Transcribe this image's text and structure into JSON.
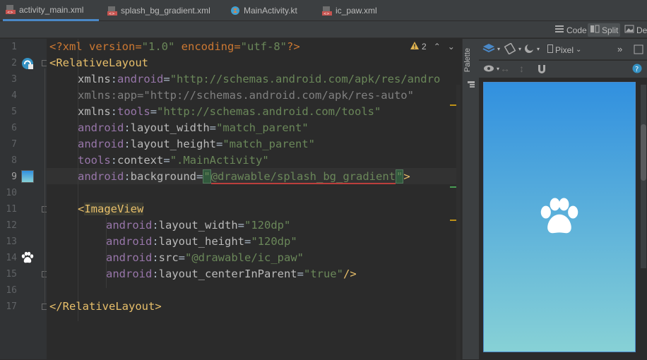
{
  "tabs": [
    {
      "label": "activity_main.xml",
      "icon": "xml-file-icon",
      "active": true
    },
    {
      "label": "splash_bg_gradient.xml",
      "icon": "xml-file-icon",
      "active": false
    },
    {
      "label": "MainActivity.kt",
      "icon": "kotlin-file-icon",
      "active": false
    },
    {
      "label": "ic_paw.xml",
      "icon": "xml-file-icon",
      "active": false
    }
  ],
  "view_modes": {
    "code": "Code",
    "split": "Split",
    "design": "Des"
  },
  "inspection": {
    "warning_count": "2"
  },
  "line_numbers": [
    "1",
    "2",
    "3",
    "4",
    "5",
    "6",
    "7",
    "8",
    "9",
    "10",
    "11",
    "12",
    "13",
    "14",
    "15",
    "16",
    "17"
  ],
  "code": {
    "l1": {
      "open": "<?xml version=",
      "v1": "\"1.0\"",
      "mid": " encoding=",
      "v2": "\"utf-8\"",
      "close": "?>"
    },
    "l2": {
      "lt": "<",
      "tag": "RelativeLayout"
    },
    "l3": {
      "ns": "xmlns",
      "colon": ":",
      "name": "android",
      "eq": "=",
      "val": "\"http://schemas.android.com/apk/res/andro"
    },
    "l4": {
      "ns": "xmlns",
      "colon": ":",
      "name": "app",
      "eq": "=",
      "val": "\"http://schemas.android.com/apk/res-auto\""
    },
    "l5": {
      "ns": "xmlns",
      "colon": ":",
      "name": "tools",
      "eq": "=",
      "val": "\"http://schemas.android.com/tools\""
    },
    "l6": {
      "ns": "android",
      "colon": ":",
      "name": "layout_width",
      "eq": "=",
      "val": "\"match_parent\""
    },
    "l7": {
      "ns": "android",
      "colon": ":",
      "name": "layout_height",
      "eq": "=",
      "val": "\"match_parent\""
    },
    "l8": {
      "ns": "tools",
      "colon": ":",
      "name": "context",
      "eq": "=",
      "val": "\".MainActivity\""
    },
    "l9": {
      "ns": "android",
      "colon": ":",
      "name": "background",
      "eq": "=",
      "q1": "\"",
      "val": "@drawable/splash_bg_gradient",
      "q2": "\"",
      "end": ">"
    },
    "l11": {
      "lt": "<",
      "tag": "ImageView"
    },
    "l12": {
      "ns": "android",
      "colon": ":",
      "name": "layout_width",
      "eq": "=",
      "val": "\"120dp\""
    },
    "l13": {
      "ns": "android",
      "colon": ":",
      "name": "layout_height",
      "eq": "=",
      "val": "\"120dp\""
    },
    "l14": {
      "ns": "android",
      "colon": ":",
      "name": "src",
      "eq": "=",
      "val": "\"@drawable/ic_paw\""
    },
    "l15": {
      "ns": "android",
      "colon": ":",
      "name": "layout_centerInParent",
      "eq": "=",
      "val": "\"true\"",
      "end": "/>"
    },
    "l17": {
      "lt": "</",
      "tag": "RelativeLayout",
      "gt": ">"
    }
  },
  "side_panel": {
    "palette": "Palette"
  },
  "design_toolbar": {
    "device": "Pixel"
  },
  "preview": {
    "gradient_start": "#3190df",
    "gradient_end": "#87d1d6",
    "icon": "paw-icon"
  },
  "colors": {
    "accent": "#4a88c7",
    "background": "#2b2b2b"
  }
}
